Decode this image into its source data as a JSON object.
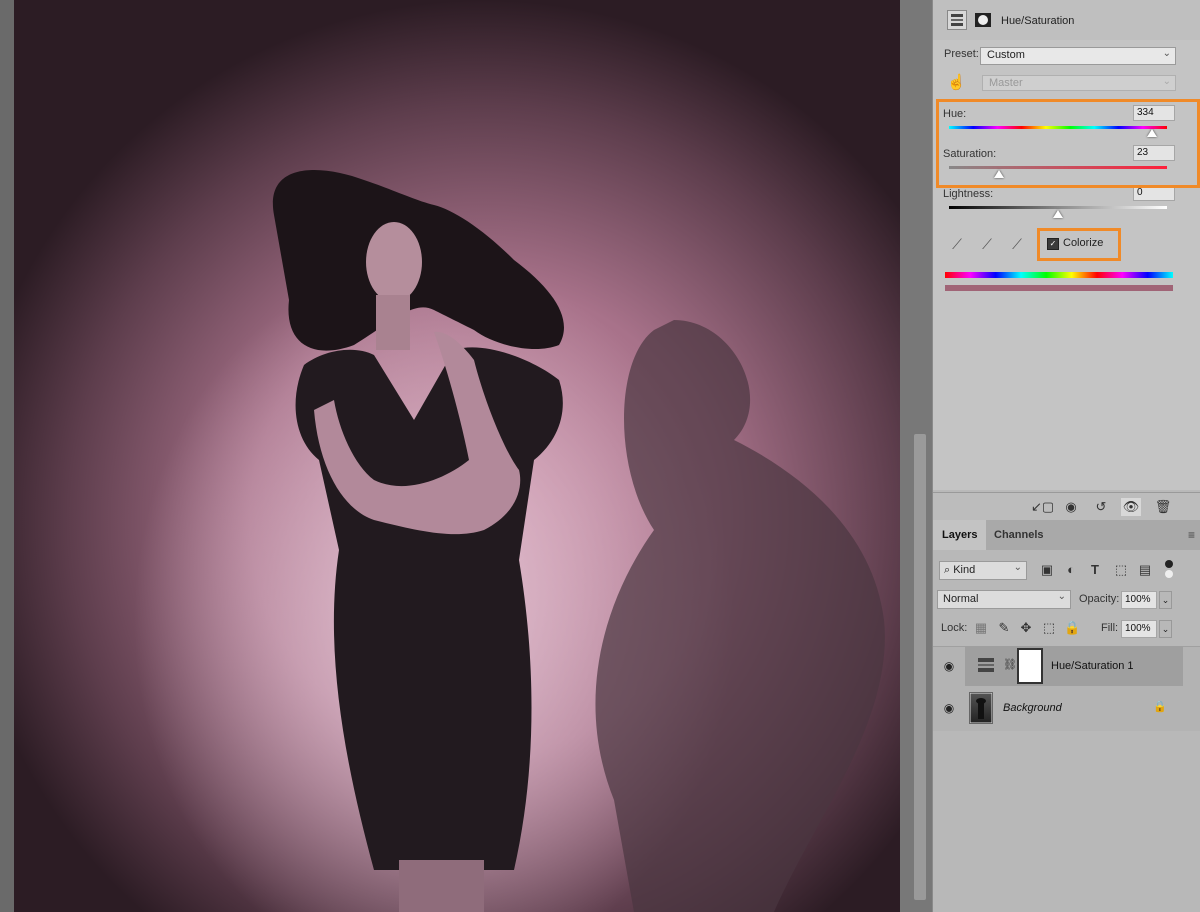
{
  "properties": {
    "title": "Hue/Saturation",
    "preset_label": "Preset:",
    "preset_value": "Custom",
    "channel_value": "Master",
    "hue_label": "Hue:",
    "hue_value": "334",
    "saturation_label": "Saturation:",
    "saturation_value": "23",
    "lightness_label": "Lightness:",
    "lightness_value": "0",
    "colorize_label": "Colorize",
    "colorize_checked": true,
    "slider_levels": {
      "hue_fraction": 0.93,
      "saturation_fraction": 0.23,
      "lightness_fraction": 0.5
    }
  },
  "layers_panel": {
    "tabs": [
      "Layers",
      "Channels"
    ],
    "filter_kind": "Kind",
    "blend_mode": "Normal",
    "opacity_label": "Opacity:",
    "opacity_value": "100%",
    "lock_label": "Lock:",
    "fill_label": "Fill:",
    "fill_value": "100%",
    "layers": [
      {
        "name": "Hue/Saturation 1",
        "selected": true
      },
      {
        "name": "Background",
        "selected": false
      }
    ]
  },
  "colors": {
    "highlight": "#f08a28",
    "tint": "#c88ea6"
  },
  "icons": {
    "filter_icons": [
      "image-filter-icon",
      "adjustment-filter-icon",
      "type-filter-icon",
      "shape-filter-icon",
      "smart-object-filter-icon"
    ],
    "lock_icons": [
      "lock-transparent-icon",
      "lock-paint-icon",
      "lock-position-icon",
      "lock-artboard-icon",
      "lock-all-icon"
    ],
    "props_bottom_icons": [
      "clip-to-layer-icon",
      "view-previous-icon",
      "reset-icon",
      "visibility-icon",
      "delete-icon"
    ]
  }
}
